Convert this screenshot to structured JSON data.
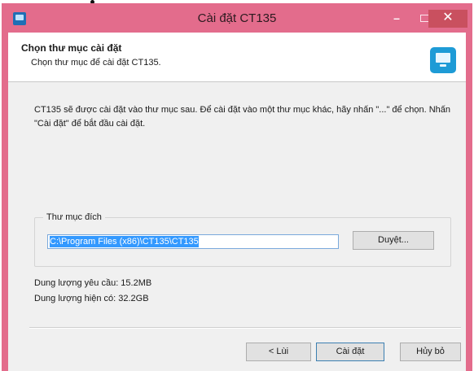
{
  "window": {
    "title": "Cài đặt CT135",
    "minimize_glyph": "–",
    "close_glyph": "✕"
  },
  "header": {
    "title": "Chọn thư mục cài đặt",
    "subtitle": "Chọn thư mục để cài đặt CT135.",
    "icon": "monitor-icon"
  },
  "body": {
    "description": "CT135 sẽ được cài đặt vào thư mục sau. Để cài đặt vào một thư mục khác, hãy nhấn \"...\" để chọn. Nhấn \"Cài đặt\" để bắt đầu cài đặt.",
    "destination": {
      "label": "Thư mục đích",
      "path": "C:\\Program Files (x86)\\CT135\\CT135",
      "browse_label": "Duyệt..."
    },
    "space_required": "Dung lượng yêu cầu: 15.2MB",
    "space_available": "Dung lượng hiện có: 32.2GB"
  },
  "footer": {
    "back_label": "< Lùi",
    "install_label": "Cài đặt",
    "cancel_label": "Hủy bỏ"
  },
  "colors": {
    "titlebar": "#e36c8c",
    "close_button": "#c9505f",
    "selection": "#3399ff"
  }
}
